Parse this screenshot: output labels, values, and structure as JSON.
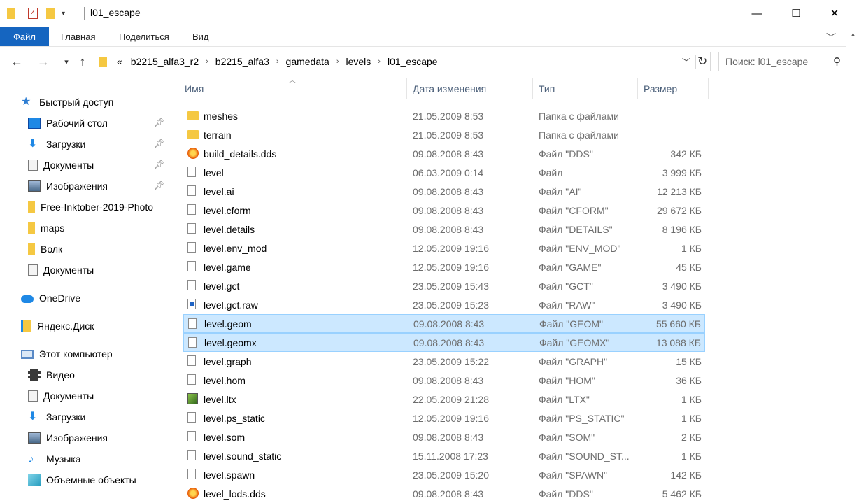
{
  "window": {
    "title": "l01_escape",
    "minimize": "—",
    "maximize": "☐",
    "close": "✕"
  },
  "ribbon": {
    "tabs": [
      "Файл",
      "Главная",
      "Поделиться",
      "Вид"
    ]
  },
  "address": {
    "overflow": "«",
    "crumbs": [
      "b2215_alfa3_r2",
      "b2215_alfa3",
      "gamedata",
      "levels",
      "l01_escape"
    ]
  },
  "search": {
    "placeholder": "Поиск: l01_escape"
  },
  "sidebar": {
    "quick_access": "Быстрый доступ",
    "pinned": [
      {
        "label": "Рабочий стол",
        "icon": "desktop-icon"
      },
      {
        "label": "Загрузки",
        "icon": "downloads-icon"
      },
      {
        "label": "Документы",
        "icon": "documents-icon"
      },
      {
        "label": "Изображения",
        "icon": "pictures-icon"
      }
    ],
    "recent": [
      {
        "label": "Free-Inktober-2019-Photo",
        "icon": "folder-icon"
      },
      {
        "label": "maps",
        "icon": "folder-icon"
      },
      {
        "label": "Волк",
        "icon": "folder-icon"
      },
      {
        "label": "Документы",
        "icon": "documents-icon"
      }
    ],
    "onedrive": "OneDrive",
    "yandex": "Яндекс.Диск",
    "this_pc": "Этот компьютер",
    "pc_items": [
      {
        "label": "Видео",
        "icon": "video-icon"
      },
      {
        "label": "Документы",
        "icon": "documents-icon"
      },
      {
        "label": "Загрузки",
        "icon": "downloads-icon"
      },
      {
        "label": "Изображения",
        "icon": "pictures-icon"
      },
      {
        "label": "Музыка",
        "icon": "music-icon"
      },
      {
        "label": "Объемные объекты",
        "icon": "3d-objects-icon"
      }
    ]
  },
  "columns": {
    "name": "Имя",
    "date": "Дата изменения",
    "type": "Тип",
    "size": "Размер"
  },
  "files": [
    {
      "name": "meshes",
      "date": "21.05.2009 8:53",
      "type": "Папка с файлами",
      "size": "",
      "icon": "folder"
    },
    {
      "name": "terrain",
      "date": "21.05.2009 8:53",
      "type": "Папка с файлами",
      "size": "",
      "icon": "folder"
    },
    {
      "name": "build_details.dds",
      "date": "09.08.2008 8:43",
      "type": "Файл \"DDS\"",
      "size": "342 КБ",
      "icon": "dds"
    },
    {
      "name": "level",
      "date": "06.03.2009 0:14",
      "type": "Файл",
      "size": "3 999 КБ",
      "icon": "doc"
    },
    {
      "name": "level.ai",
      "date": "09.08.2008 8:43",
      "type": "Файл \"AI\"",
      "size": "12 213 КБ",
      "icon": "doc"
    },
    {
      "name": "level.cform",
      "date": "09.08.2008 8:43",
      "type": "Файл \"CFORM\"",
      "size": "29 672 КБ",
      "icon": "doc"
    },
    {
      "name": "level.details",
      "date": "09.08.2008 8:43",
      "type": "Файл \"DETAILS\"",
      "size": "8 196 КБ",
      "icon": "doc"
    },
    {
      "name": "level.env_mod",
      "date": "12.05.2009 19:16",
      "type": "Файл \"ENV_MOD\"",
      "size": "1 КБ",
      "icon": "doc"
    },
    {
      "name": "level.game",
      "date": "12.05.2009 19:16",
      "type": "Файл \"GAME\"",
      "size": "45 КБ",
      "icon": "doc"
    },
    {
      "name": "level.gct",
      "date": "23.05.2009 15:43",
      "type": "Файл \"GCT\"",
      "size": "3 490 КБ",
      "icon": "doc"
    },
    {
      "name": "level.gct.raw",
      "date": "23.05.2009 15:23",
      "type": "Файл \"RAW\"",
      "size": "3 490 КБ",
      "icon": "raw"
    },
    {
      "name": "level.geom",
      "date": "09.08.2008 8:43",
      "type": "Файл \"GEOM\"",
      "size": "55 660 КБ",
      "icon": "doc",
      "selected": true
    },
    {
      "name": "level.geomx",
      "date": "09.08.2008 8:43",
      "type": "Файл \"GEOMX\"",
      "size": "13 088 КБ",
      "icon": "doc",
      "selected": true
    },
    {
      "name": "level.graph",
      "date": "23.05.2009 15:22",
      "type": "Файл \"GRAPH\"",
      "size": "15 КБ",
      "icon": "doc"
    },
    {
      "name": "level.hom",
      "date": "09.08.2008 8:43",
      "type": "Файл \"HOM\"",
      "size": "36 КБ",
      "icon": "doc"
    },
    {
      "name": "level.ltx",
      "date": "22.05.2009 21:28",
      "type": "Файл \"LTX\"",
      "size": "1 КБ",
      "icon": "ltx"
    },
    {
      "name": "level.ps_static",
      "date": "12.05.2009 19:16",
      "type": "Файл \"PS_STATIC\"",
      "size": "1 КБ",
      "icon": "doc"
    },
    {
      "name": "level.som",
      "date": "09.08.2008 8:43",
      "type": "Файл \"SOM\"",
      "size": "2 КБ",
      "icon": "doc"
    },
    {
      "name": "level.sound_static",
      "date": "15.11.2008 17:23",
      "type": "Файл \"SOUND_ST...",
      "size": "1 КБ",
      "icon": "doc"
    },
    {
      "name": "level.spawn",
      "date": "23.05.2009 15:20",
      "type": "Файл \"SPAWN\"",
      "size": "142 КБ",
      "icon": "doc"
    },
    {
      "name": "level_lods.dds",
      "date": "09.08.2008 8:43",
      "type": "Файл \"DDS\"",
      "size": "5 462 КБ",
      "icon": "dds"
    }
  ],
  "colors": {
    "file_tab": "#1565c0",
    "selection": "#cce8ff",
    "selection_border": "#99d1ff",
    "folder": "#f5c842"
  }
}
